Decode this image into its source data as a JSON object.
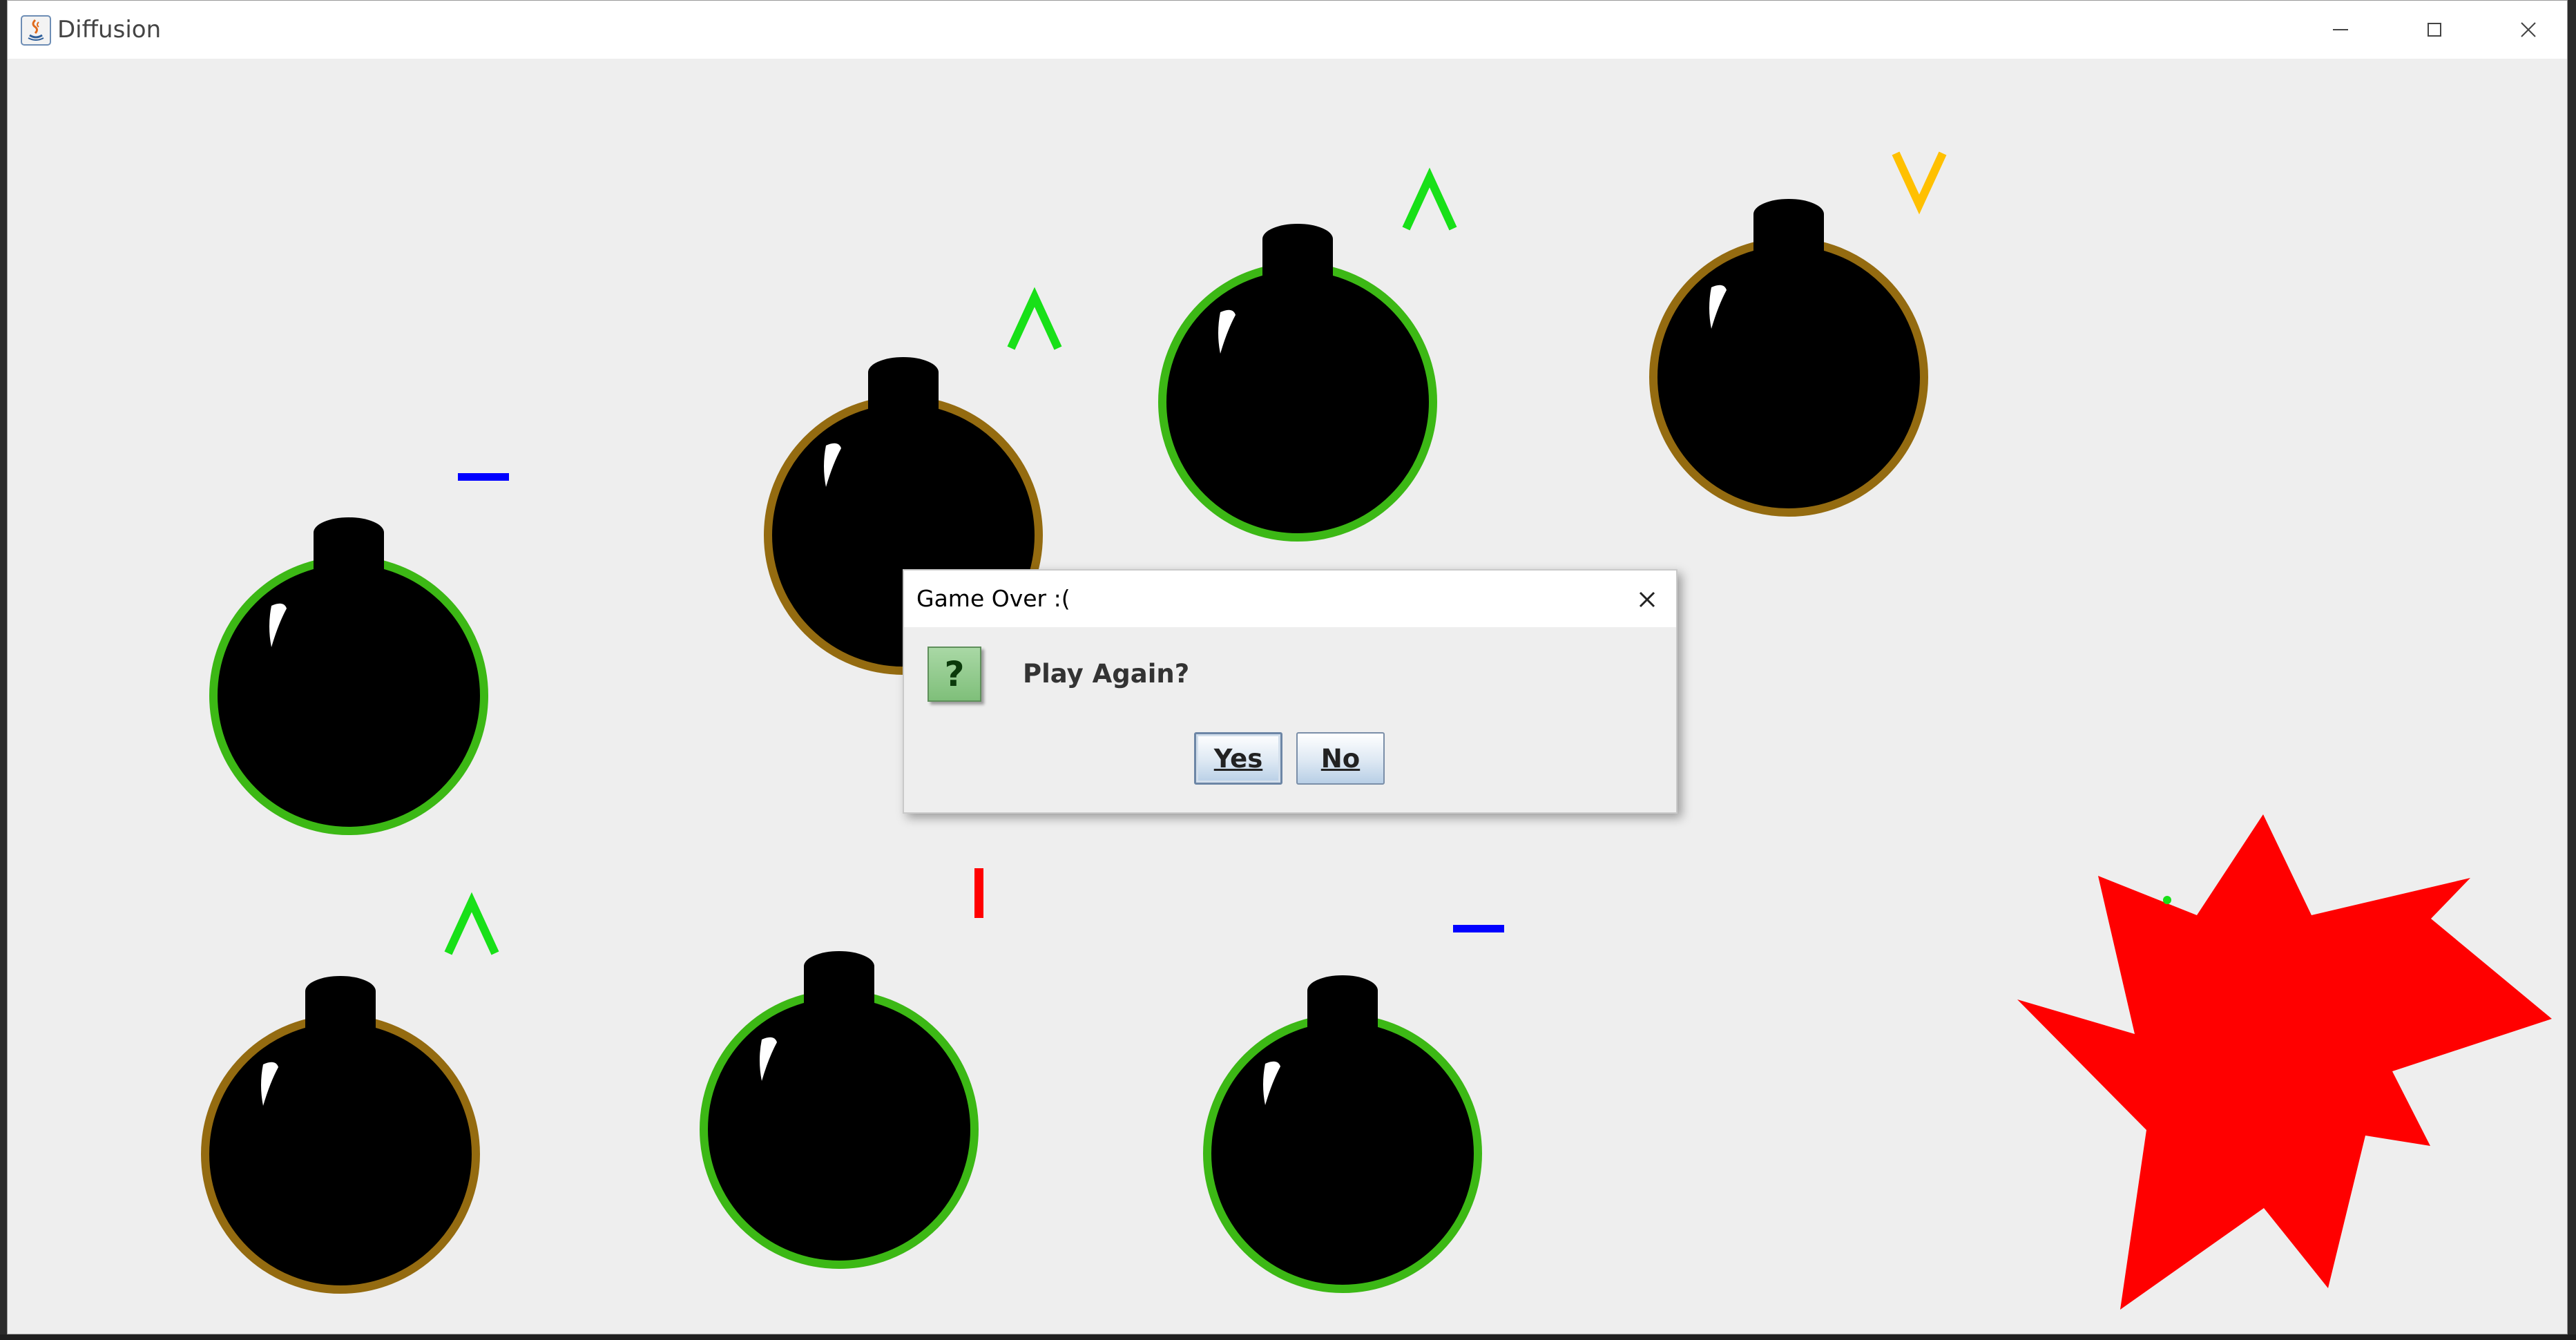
{
  "window": {
    "title": "Diffusion",
    "controls": [
      "minimize",
      "maximize",
      "close"
    ]
  },
  "game": {
    "bombs": [
      {
        "ring_color": "#3cb815",
        "label": ""
      },
      {
        "ring_color": "#946b10",
        "label": ""
      },
      {
        "ring_color": "#3cb815",
        "label": ""
      },
      {
        "ring_color": "#946b10",
        "label": ""
      },
      {
        "ring_color": "#946b10",
        "label": ""
      },
      {
        "ring_color": "#3cb815",
        "label": ""
      },
      {
        "ring_color": "#3cb815",
        "label": ""
      }
    ],
    "indicators": [
      {
        "symbol": "minus",
        "color": "#0000ff"
      },
      {
        "symbol": "^",
        "color": "#18e018"
      },
      {
        "symbol": "^",
        "color": "#18e018"
      },
      {
        "symbol": "v",
        "color": "#ffc000"
      },
      {
        "symbol": "^",
        "color": "#18e018"
      },
      {
        "symbol": "bar",
        "color": "#ff0000"
      },
      {
        "symbol": "minus",
        "color": "#0000ff"
      }
    ],
    "explosion_color": "#ff0000"
  },
  "dialog": {
    "title": "Game Over :(",
    "message": "Play Again?",
    "icon": "question-icon",
    "yes_label": "Yes",
    "no_label": "No"
  }
}
